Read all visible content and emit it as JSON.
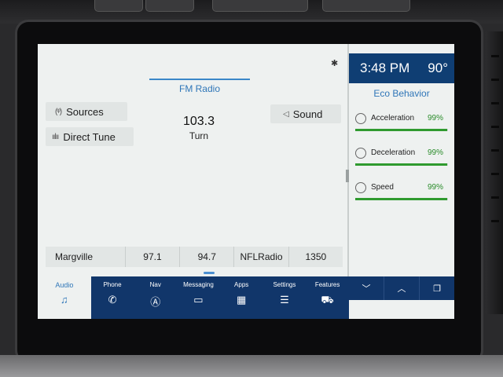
{
  "status": {
    "time": "3:48 PM",
    "temperature": "90°"
  },
  "audio": {
    "mode": "FM Radio",
    "frequency": "103.3",
    "station_name": "Turn",
    "sources_label": "Sources",
    "direct_tune_label": "Direct Tune",
    "sound_label": "Sound"
  },
  "presets": [
    {
      "label": "Margville"
    },
    {
      "label": "97.1"
    },
    {
      "label": "94.7"
    },
    {
      "label": "NFLRadio"
    },
    {
      "label": "1350"
    }
  ],
  "eco": {
    "title": "Eco Behavior",
    "metrics": [
      {
        "label": "Acceleration",
        "value": "99%",
        "level": 0.99
      },
      {
        "label": "Deceleration",
        "value": "99%",
        "level": 0.99
      },
      {
        "label": "Speed",
        "value": "99%",
        "level": 0.99
      }
    ]
  },
  "nav": {
    "items": [
      {
        "label": "Audio",
        "icon": "music-note-icon"
      },
      {
        "label": "Phone",
        "icon": "phone-icon"
      },
      {
        "label": "Nav",
        "icon": "navigation-icon"
      },
      {
        "label": "Messaging",
        "icon": "chat-icon"
      },
      {
        "label": "Apps",
        "icon": "apps-grid-icon"
      },
      {
        "label": "Settings",
        "icon": "sliders-icon"
      },
      {
        "label": "Features",
        "icon": "truck-icon"
      }
    ]
  },
  "colors": {
    "accent": "#2f76b8",
    "nav_bg": "#11366a",
    "eco_green": "#2f9a2f"
  }
}
